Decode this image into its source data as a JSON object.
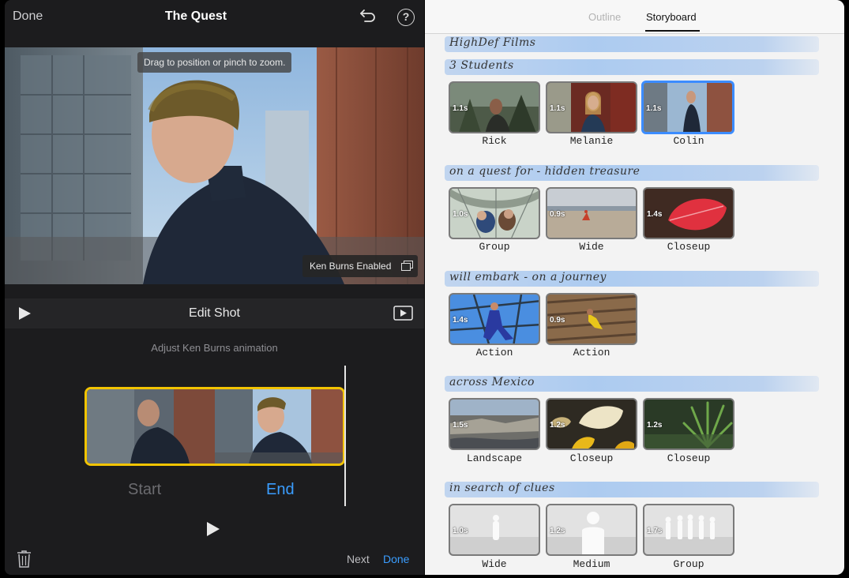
{
  "app": {
    "title": "The Quest",
    "done_label": "Done"
  },
  "preview": {
    "hint": "Drag to position or pinch to zoom.",
    "ken_burns_badge": "Ken Burns Enabled"
  },
  "edit_bar": {
    "title": "Edit Shot"
  },
  "ken_burns": {
    "subtitle": "Adjust Ken Burns animation",
    "start_label": "Start",
    "end_label": "End"
  },
  "bottom_bar": {
    "next_label": "Next",
    "done_label": "Done"
  },
  "tabs": {
    "outline": "Outline",
    "storyboard": "Storyboard"
  },
  "storyboard": {
    "headings": [
      "HighDef Films",
      "3 Students",
      "on a quest for - hidden treasure",
      "will embark - on a journey",
      "across Mexico",
      "in search of clues"
    ],
    "rows": [
      [
        {
          "label": "Rick",
          "duration": "1.1s"
        },
        {
          "label": "Melanie",
          "duration": "1.1s"
        },
        {
          "label": "Colin",
          "duration": "1.1s"
        }
      ],
      [
        {
          "label": "Group",
          "duration": "1.0s"
        },
        {
          "label": "Wide",
          "duration": "0.9s"
        },
        {
          "label": "Closeup",
          "duration": "1.4s"
        }
      ],
      [
        {
          "label": "Action",
          "duration": "1.4s"
        },
        {
          "label": "Action",
          "duration": "0.9s"
        }
      ],
      [
        {
          "label": "Landscape",
          "duration": "1.5s"
        },
        {
          "label": "Closeup",
          "duration": "1.2s"
        },
        {
          "label": "Closeup",
          "duration": "1.2s"
        }
      ],
      [
        {
          "label": "Wide",
          "duration": "1.0s"
        },
        {
          "label": "Medium",
          "duration": "1.2s"
        },
        {
          "label": "Group",
          "duration": "1.7s"
        }
      ]
    ]
  },
  "colors": {
    "accent": "#3a9dff",
    "selection_yellow": "#f2c400",
    "selected_clip": "#3b8cff",
    "heading_band": "#a0c4f0"
  }
}
